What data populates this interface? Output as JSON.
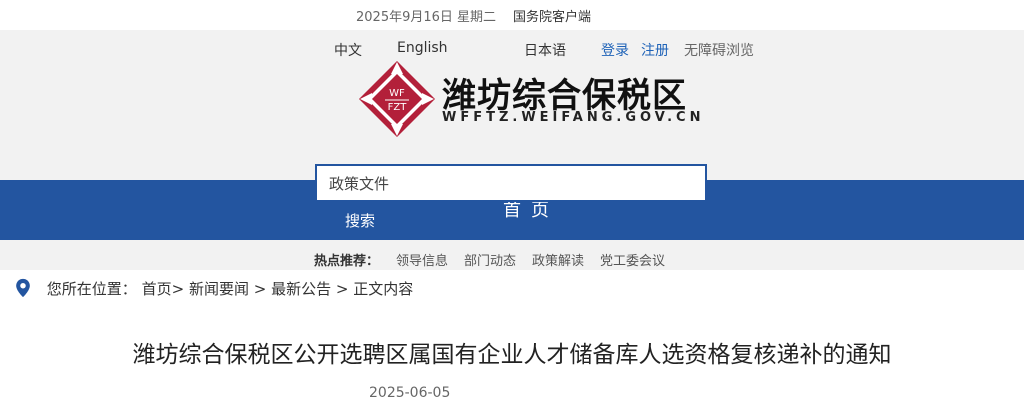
{
  "topbar": {
    "date": "2025年9月16日",
    "weekday": "星期二",
    "client_link": "国务院客户端"
  },
  "header": {
    "lang_zh": "中文",
    "lang_en": "English",
    "lang_ja": "日本语",
    "login": "登录",
    "register": "注册",
    "accessibility": "无障碍浏览",
    "logo_text_top": "WF",
    "logo_text_bottom": "FZT",
    "site_title": "潍坊综合保税区",
    "site_domain": "WFFTZ.WEIFANG.GOV.CN"
  },
  "nav": {
    "home": "首页"
  },
  "search": {
    "value": "政策文件",
    "button_label": "搜索"
  },
  "hot": {
    "label": "热点推荐：",
    "items": [
      "领导信息",
      "部门动态",
      "政策解读",
      "党工委会议"
    ]
  },
  "breadcrumb": {
    "prefix": "您所在位置：",
    "items": [
      "首页",
      "新闻要闻",
      "最新公告",
      "正文内容"
    ],
    "separators": [
      ">",
      ">",
      ">"
    ]
  },
  "article": {
    "title": "潍坊综合保税区公开选聘区属国有企业人才储备库人选资格复核递补的通知",
    "date": "2025-06-05"
  },
  "colors": {
    "nav_blue": "#2355a0",
    "link_blue": "#1f63b8",
    "logo_red": "#b3203a",
    "header_gray": "#f2f2f2"
  }
}
